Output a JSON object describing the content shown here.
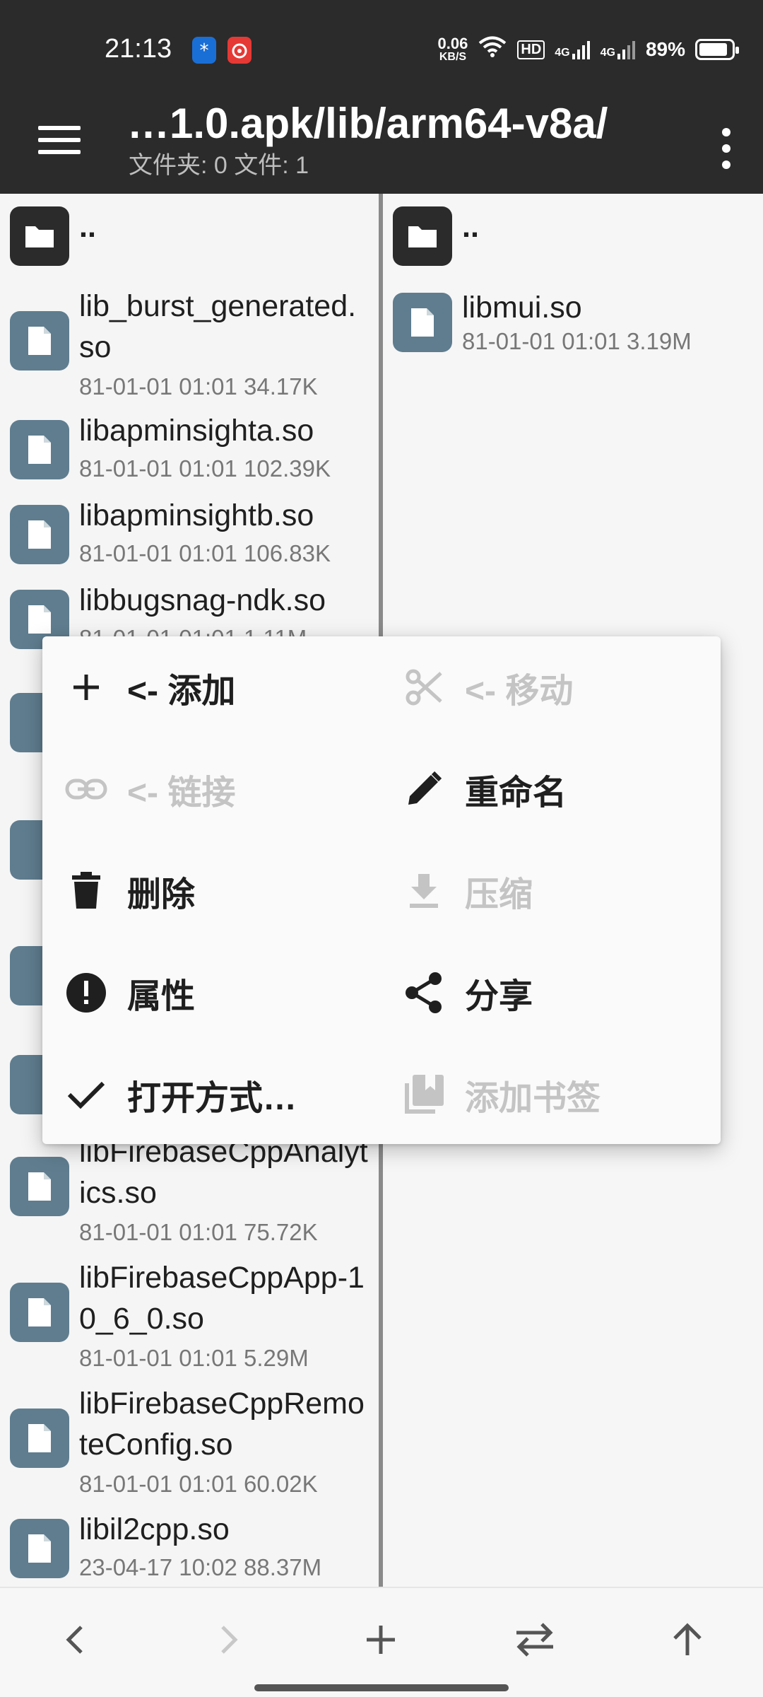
{
  "status_bar": {
    "time": "21:13",
    "net_speed_value": "0.06",
    "net_speed_unit": "KB/S",
    "hd_label": "HD",
    "sig1_label": "4G",
    "sig2_label": "4G",
    "battery": "89%",
    "battery_level": 0.89
  },
  "app_bar": {
    "path": "…1.0.apk/lib/arm64-v8a/",
    "subtitle": "文件夹: 0   文件: 1"
  },
  "left_pane": {
    "parent_label": "..",
    "items": [
      {
        "name": "lib_burst_generated.so",
        "meta": "81-01-01 01:01 34.17K"
      },
      {
        "name": "libapminsighta.so",
        "meta": "81-01-01 01:01 102.39K"
      },
      {
        "name": "libapminsightb.so",
        "meta": "81-01-01 01:01 106.83K"
      },
      {
        "name": "libbugsnag-ndk.so",
        "meta": "81-01-01 01:01 1.11M"
      },
      {
        "name": "libFirebaseCppAnalytics.so",
        "meta": "81-01-01 01:01 75.72K"
      },
      {
        "name": "libFirebaseCppApp-10_6_0.so",
        "meta": "81-01-01 01:01 5.29M"
      },
      {
        "name": "libFirebaseCppRemoteConfig.so",
        "meta": "81-01-01 01:01 60.02K"
      },
      {
        "name": "libil2cpp.so",
        "meta": "23-04-17 10:02 88.37M"
      }
    ]
  },
  "right_pane": {
    "parent_label": "..",
    "items": [
      {
        "name": "libmui.so",
        "meta": "81-01-01 01:01 3.19M"
      }
    ]
  },
  "context_menu": {
    "add": "<- 添加",
    "move": "<- 移动",
    "link": "<- 链接",
    "rename": "重命名",
    "delete": "删除",
    "compress": "压缩",
    "properties": "属性",
    "share": "分享",
    "open_with": "打开方式…",
    "add_bookmark": "添加书签"
  },
  "colors": {
    "bar_bg": "#2b2b2b",
    "file_icon": "#5f7d8f",
    "folder_icon": "#2b2b2b",
    "disabled_text": "#c4c4c4"
  }
}
